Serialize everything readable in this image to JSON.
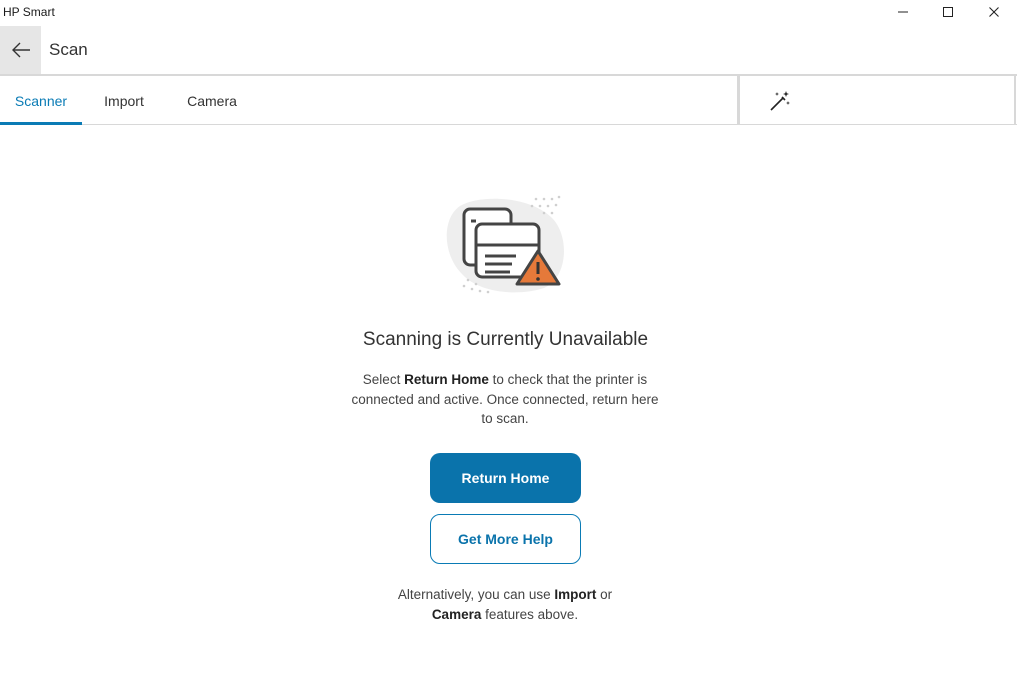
{
  "window": {
    "app_title": "HP Smart",
    "minimize_icon": "minimize-icon",
    "maximize_icon": "maximize-icon",
    "close_icon": "close-icon"
  },
  "header": {
    "back_icon": "arrow-left-icon",
    "title": "Scan"
  },
  "tabs": [
    {
      "label": "Scanner",
      "selected": true
    },
    {
      "label": "Import",
      "selected": false
    },
    {
      "label": "Camera",
      "selected": false
    }
  ],
  "toolbar": {
    "magic_icon": "magic-wand-icon"
  },
  "main": {
    "illustration_icon": "scanner-warning-icon",
    "heading": "Scanning is Currently Unavailable",
    "desc_prefix": "Select ",
    "desc_strong": "Return Home",
    "desc_suffix": " to check that the printer is connected and active. Once connected, return here to scan.",
    "primary_button": "Return Home",
    "secondary_button": "Get More Help",
    "alt_prefix": "Alternatively, you can use ",
    "alt_strong1": "Import",
    "alt_mid": " or",
    "alt_strong2": "Camera",
    "alt_suffix": " features above."
  },
  "colors": {
    "accent": "#0a73ab",
    "warning": "#e5793a"
  }
}
